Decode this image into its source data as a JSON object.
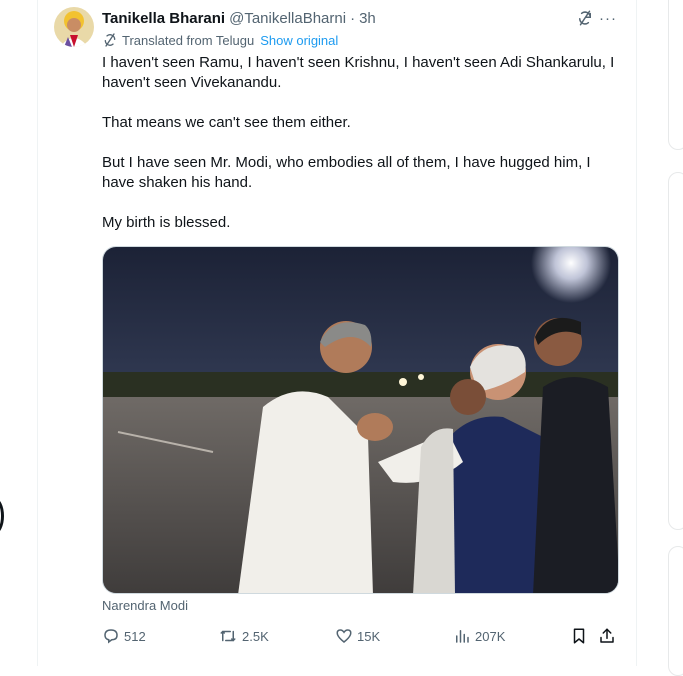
{
  "tweet": {
    "author_name": "Tanikella Bharani",
    "author_handle": "@TanikellaBharni",
    "separator": "·",
    "time": "3h",
    "translated_label": "Translated from Telugu",
    "show_original_label": "Show original",
    "paragraphs": [
      "I haven't seen Ramu, I haven't seen Krishnu, I haven't seen Adi Shankarulu, I haven't seen Vivekanandu.",
      "That means we can't see them either.",
      "But I have seen Mr. Modi, who embodies all of them, I have hugged him, I have shaken his hand.",
      "My birth is blessed."
    ],
    "media_caption": "Narendra Modi",
    "more_icon": "···"
  },
  "actions": {
    "replies": "512",
    "retweets": "2.5K",
    "likes": "15K",
    "views": "207K"
  },
  "icons": {
    "reply": "reply-icon",
    "retweet": "retweet-icon",
    "like": "heart-icon",
    "views": "views-icon",
    "bookmark": "bookmark-icon",
    "share": "share-icon",
    "translate": "translate-icon",
    "more": "more-icon"
  },
  "colors": {
    "link": "#1d9bf0",
    "secondary_text": "#536471",
    "primary_text": "#0f1419"
  }
}
